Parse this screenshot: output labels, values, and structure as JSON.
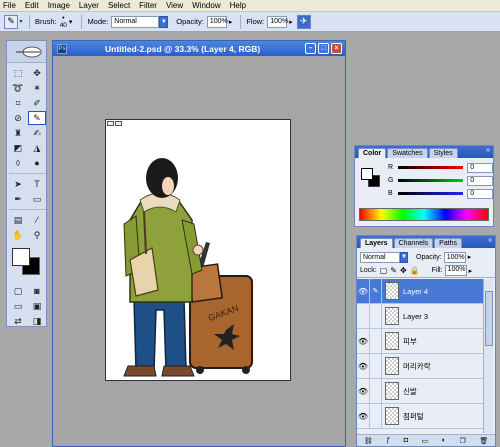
{
  "menu": [
    "File",
    "Edit",
    "Image",
    "Layer",
    "Select",
    "Filter",
    "View",
    "Window",
    "Help"
  ],
  "options": {
    "brush_label": "Brush:",
    "brush_size": "40",
    "mode_label": "Mode:",
    "mode_value": "Normal",
    "opacity_label": "Opacity:",
    "opacity_value": "100%",
    "flow_label": "Flow:",
    "flow_value": "100%"
  },
  "document": {
    "title": "Untitled-2.psd @ 33.3% (Layer 4, RGB)",
    "canvas_text": "GAKAN"
  },
  "color_panel": {
    "tabs": [
      "Color",
      "Swatches",
      "Styles"
    ],
    "channels": [
      {
        "label": "R",
        "value": "0",
        "color": "#e02020"
      },
      {
        "label": "G",
        "value": "0",
        "color": "#20a020"
      },
      {
        "label": "B",
        "value": "0",
        "color": "#2040e0"
      }
    ]
  },
  "layers_panel": {
    "tabs": [
      "Layers",
      "Channels",
      "Paths"
    ],
    "blend_mode": "Normal",
    "opacity_label": "Opacity:",
    "opacity_value": "100%",
    "lock_label": "Lock:",
    "fill_label": "Fill:",
    "fill_value": "100%",
    "layers": [
      {
        "name": "Layer 4",
        "visible": true,
        "selected": true
      },
      {
        "name": "Layer 3",
        "visible": false,
        "selected": false
      },
      {
        "name": "피부",
        "visible": true,
        "selected": false
      },
      {
        "name": "머리카락",
        "visible": true,
        "selected": false
      },
      {
        "name": "신발",
        "visible": true,
        "selected": false
      },
      {
        "name": "점퍼털",
        "visible": true,
        "selected": false
      }
    ]
  }
}
